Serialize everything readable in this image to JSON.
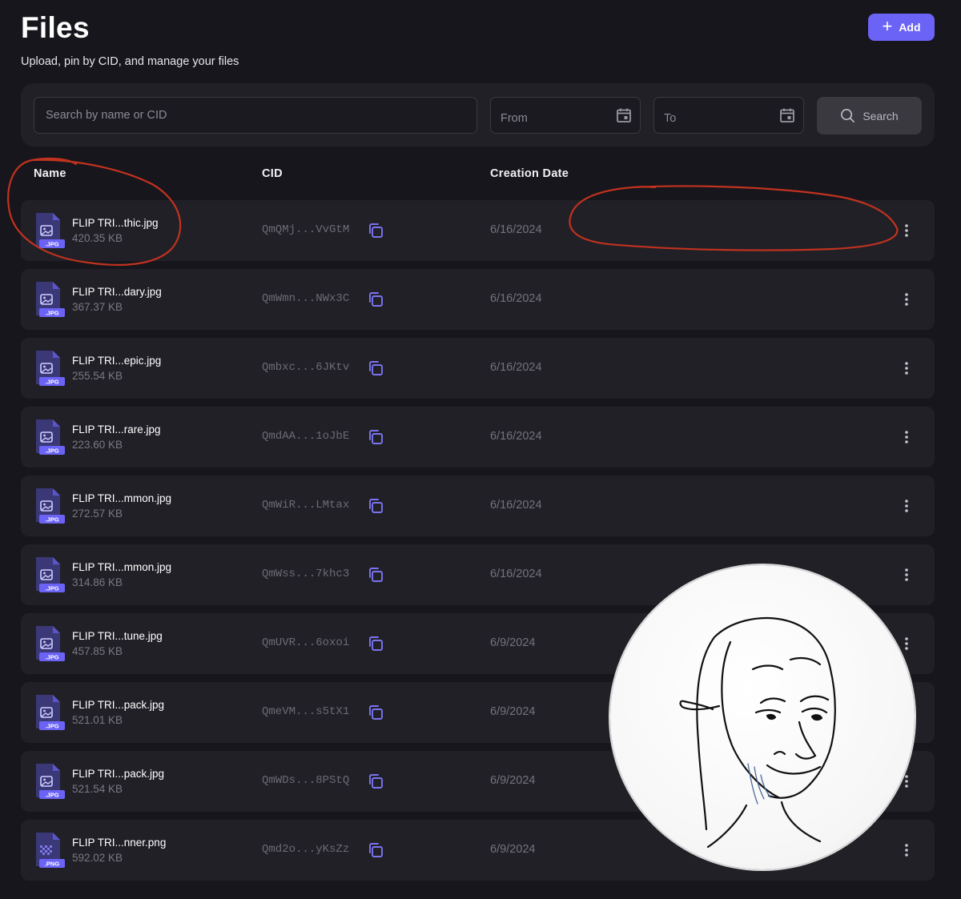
{
  "header": {
    "title": "Files",
    "subtitle": "Upload, pin by CID, and manage your files",
    "add_label": "Add"
  },
  "filters": {
    "search_placeholder": "Search by name or CID",
    "from_label": "From",
    "to_label": "To",
    "search_button_label": "Search"
  },
  "table": {
    "columns": [
      "Name",
      "CID",
      "Creation Date"
    ],
    "rows": [
      {
        "name": "FLIP TRI...thic.jpg",
        "size": "420.35 KB",
        "cid": "QmQMj...VvGtM",
        "date": "6/16/2024",
        "badge": ".JPG"
      },
      {
        "name": "FLIP TRI...dary.jpg",
        "size": "367.37 KB",
        "cid": "QmWmn...NWx3C",
        "date": "6/16/2024",
        "badge": ".JPG"
      },
      {
        "name": "FLIP TRI...epic.jpg",
        "size": "255.54 KB",
        "cid": "Qmbxc...6JKtv",
        "date": "6/16/2024",
        "badge": ".JPG"
      },
      {
        "name": "FLIP TRI...rare.jpg",
        "size": "223.60 KB",
        "cid": "QmdAA...1oJbE",
        "date": "6/16/2024",
        "badge": ".JPG"
      },
      {
        "name": "FLIP TRI...mmon.jpg",
        "size": "272.57 KB",
        "cid": "QmWiR...LMtax",
        "date": "6/16/2024",
        "badge": ".JPG"
      },
      {
        "name": "FLIP TRI...mmon.jpg",
        "size": "314.86 KB",
        "cid": "QmWss...7khc3",
        "date": "6/16/2024",
        "badge": ".JPG"
      },
      {
        "name": "FLIP TRI...tune.jpg",
        "size": "457.85 KB",
        "cid": "QmUVR...6oxoi",
        "date": "6/9/2024",
        "badge": ".JPG"
      },
      {
        "name": "FLIP TRI...pack.jpg",
        "size": "521.01 KB",
        "cid": "QmeVM...s5tX1",
        "date": "6/9/2024",
        "badge": ".JPG"
      },
      {
        "name": "FLIP TRI...pack.jpg",
        "size": "521.54 KB",
        "cid": "QmWDs...8PStQ",
        "date": "6/9/2024",
        "badge": ".JPG"
      },
      {
        "name": "FLIP TRI...nner.png",
        "size": "592.02 KB",
        "cid": "Qmd2o...yKsZz",
        "date": "6/9/2024",
        "badge": ".PNG"
      }
    ]
  },
  "colors": {
    "background": "#17161c",
    "panel": "#212027",
    "accent": "#6b63f6",
    "annotation": "#c1321f"
  },
  "icons": {
    "add": "plus-icon",
    "calendar": "calendar-icon",
    "search": "search-icon",
    "file_jpg": "jpg-file-icon",
    "file_png": "png-file-icon",
    "copy": "copy-icon",
    "more": "kebab-menu-icon"
  }
}
